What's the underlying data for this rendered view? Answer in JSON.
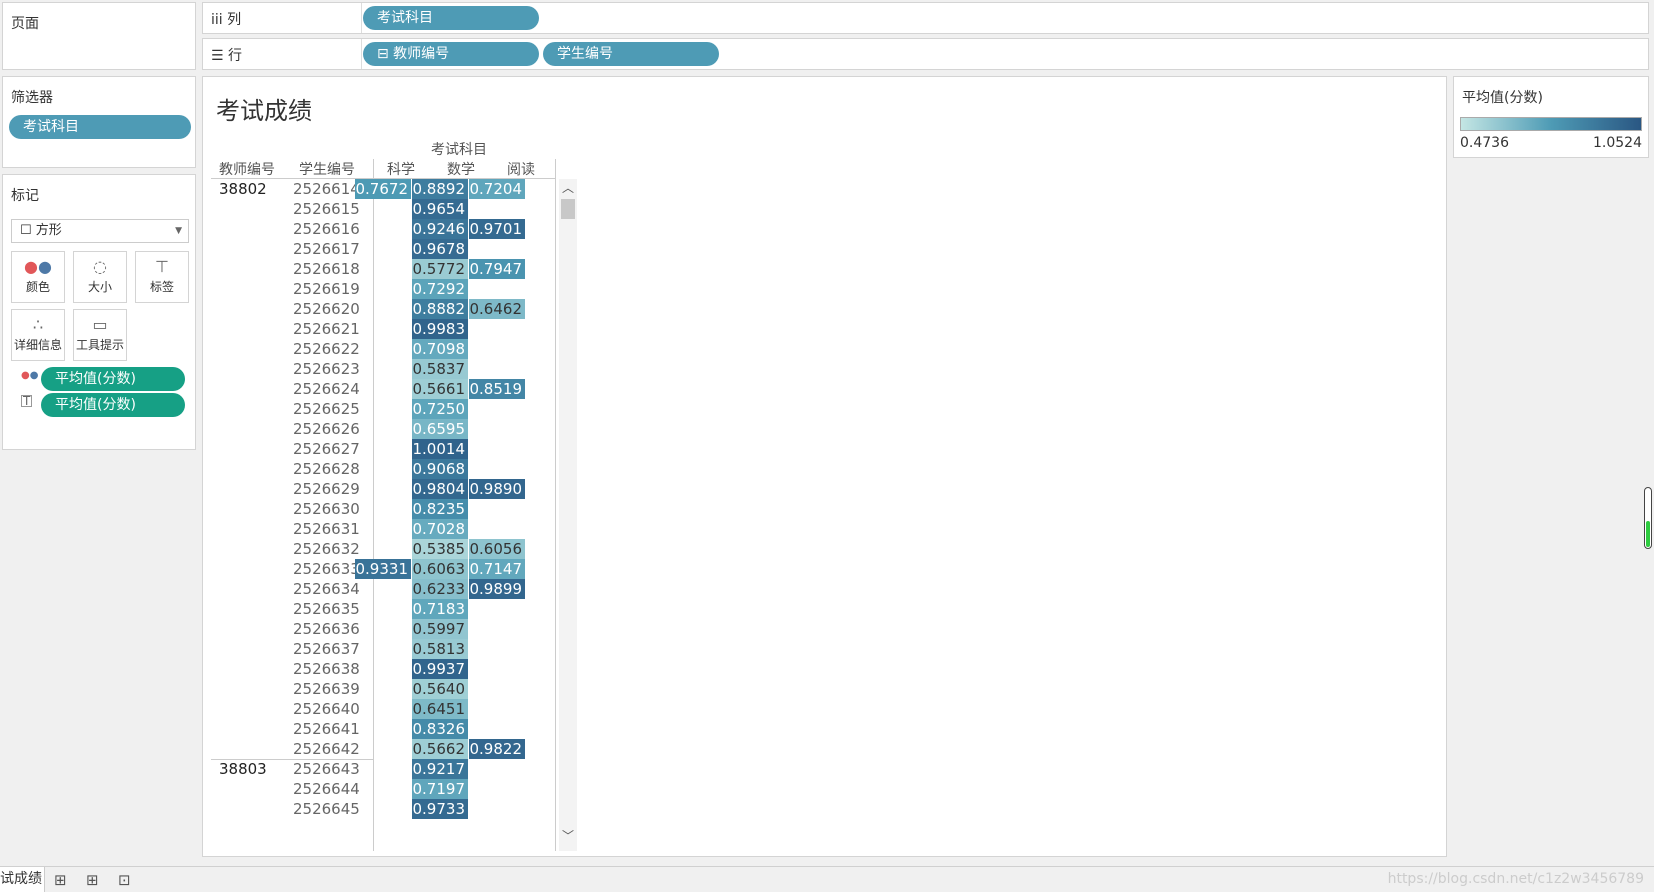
{
  "pages_label": "页面",
  "columns_shelf": {
    "icon": "iii",
    "label": "列",
    "pills": [
      "考试科目"
    ]
  },
  "rows_shelf": {
    "icon": "☰",
    "label": "行",
    "pills": [
      "⊟ 教师编号",
      "学生编号"
    ]
  },
  "filters": {
    "title": "筛选器",
    "pills": [
      "考试科目"
    ]
  },
  "marks": {
    "title": "标记",
    "type": "☐ 方形",
    "buttons": [
      {
        "label": "颜色",
        "icon": "color-dots-icon"
      },
      {
        "label": "大小",
        "icon": "size-circles-icon"
      },
      {
        "label": "标签",
        "icon": "label-t-icon"
      },
      {
        "label": "详细信息",
        "icon": "detail-dots-icon"
      },
      {
        "label": "工具提示",
        "icon": "tooltip-bubble-icon"
      }
    ],
    "fields": [
      "平均值(分数)",
      "平均值(分数)"
    ]
  },
  "view": {
    "title": "考试成绩",
    "header_top": "考试科目",
    "header_cols": [
      "教师编号",
      "学生编号",
      "科学",
      "数学",
      "阅读"
    ]
  },
  "legend": {
    "title": "平均值(分数)",
    "min": "0.4736",
    "max": "1.0524"
  },
  "bottom_tab": "试成绩",
  "watermark": "https://blog.csdn.net/c1z2w3456789",
  "colors": {
    "accent_blue": "#4e9bb5",
    "pill_green": "#16a085",
    "scale_low": "#c4e6e4",
    "scale_high": "#2a5783"
  },
  "chart_data": {
    "type": "heatmap",
    "title": "考试成绩",
    "color_range": [
      0.4736,
      1.0524
    ],
    "columns": [
      "科学",
      "数学",
      "阅读"
    ],
    "rows": [
      {
        "teacher": "38802",
        "student": "2526614",
        "values": [
          "0.7672",
          "0.8892",
          "0.7204"
        ]
      },
      {
        "teacher": "",
        "student": "2526615",
        "values": [
          "",
          "0.9654",
          ""
        ]
      },
      {
        "teacher": "",
        "student": "2526616",
        "values": [
          "",
          "0.9246",
          "0.9701"
        ]
      },
      {
        "teacher": "",
        "student": "2526617",
        "values": [
          "",
          "0.9678",
          ""
        ]
      },
      {
        "teacher": "",
        "student": "2526618",
        "values": [
          "",
          "0.5772",
          "0.7947"
        ]
      },
      {
        "teacher": "",
        "student": "2526619",
        "values": [
          "",
          "0.7292",
          ""
        ]
      },
      {
        "teacher": "",
        "student": "2526620",
        "values": [
          "",
          "0.8882",
          "0.6462"
        ]
      },
      {
        "teacher": "",
        "student": "2526621",
        "values": [
          "",
          "0.9983",
          ""
        ]
      },
      {
        "teacher": "",
        "student": "2526622",
        "values": [
          "",
          "0.7098",
          ""
        ]
      },
      {
        "teacher": "",
        "student": "2526623",
        "values": [
          "",
          "0.5837",
          ""
        ]
      },
      {
        "teacher": "",
        "student": "2526624",
        "values": [
          "",
          "0.5661",
          "0.8519"
        ]
      },
      {
        "teacher": "",
        "student": "2526625",
        "values": [
          "",
          "0.7250",
          ""
        ]
      },
      {
        "teacher": "",
        "student": "2526626",
        "values": [
          "",
          "0.6595",
          ""
        ]
      },
      {
        "teacher": "",
        "student": "2526627",
        "values": [
          "",
          "1.0014",
          ""
        ]
      },
      {
        "teacher": "",
        "student": "2526628",
        "values": [
          "",
          "0.9068",
          ""
        ]
      },
      {
        "teacher": "",
        "student": "2526629",
        "values": [
          "",
          "0.9804",
          "0.9890"
        ]
      },
      {
        "teacher": "",
        "student": "2526630",
        "values": [
          "",
          "0.8235",
          ""
        ]
      },
      {
        "teacher": "",
        "student": "2526631",
        "values": [
          "",
          "0.7028",
          ""
        ]
      },
      {
        "teacher": "",
        "student": "2526632",
        "values": [
          "",
          "0.5385",
          "0.6056"
        ]
      },
      {
        "teacher": "",
        "student": "2526633",
        "values": [
          "0.9331",
          "0.6063",
          "0.7147"
        ]
      },
      {
        "teacher": "",
        "student": "2526634",
        "values": [
          "",
          "0.6233",
          "0.9899"
        ]
      },
      {
        "teacher": "",
        "student": "2526635",
        "values": [
          "",
          "0.7183",
          ""
        ]
      },
      {
        "teacher": "",
        "student": "2526636",
        "values": [
          "",
          "0.5997",
          ""
        ]
      },
      {
        "teacher": "",
        "student": "2526637",
        "values": [
          "",
          "0.5813",
          ""
        ]
      },
      {
        "teacher": "",
        "student": "2526638",
        "values": [
          "",
          "0.9937",
          ""
        ]
      },
      {
        "teacher": "",
        "student": "2526639",
        "values": [
          "",
          "0.5640",
          ""
        ]
      },
      {
        "teacher": "",
        "student": "2526640",
        "values": [
          "",
          "0.6451",
          ""
        ]
      },
      {
        "teacher": "",
        "student": "2526641",
        "values": [
          "",
          "0.8326",
          ""
        ]
      },
      {
        "teacher": "",
        "student": "2526642",
        "values": [
          "",
          "0.5662",
          "0.9822"
        ]
      },
      {
        "teacher": "38803",
        "student": "2526643",
        "values": [
          "",
          "0.9217",
          ""
        ]
      },
      {
        "teacher": "",
        "student": "2526644",
        "values": [
          "",
          "0.7197",
          ""
        ]
      },
      {
        "teacher": "",
        "student": "2526645",
        "values": [
          "",
          "0.9733",
          ""
        ]
      }
    ]
  }
}
